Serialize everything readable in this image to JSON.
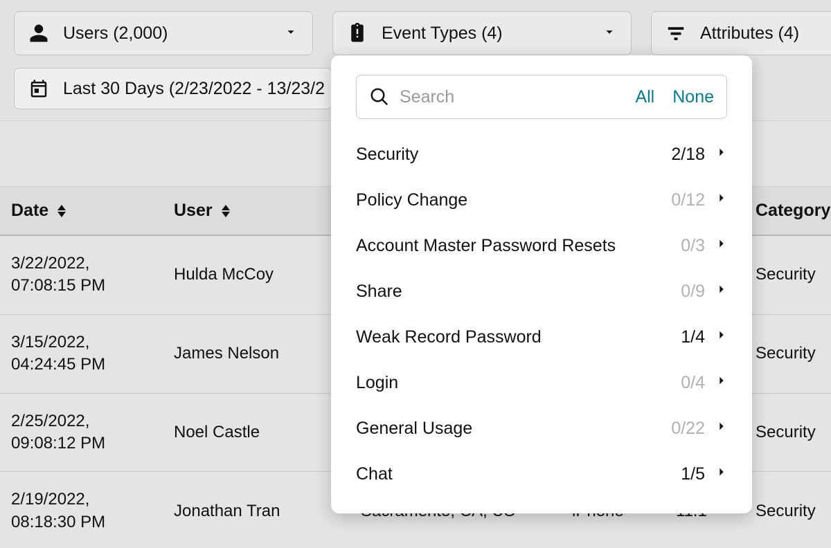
{
  "filters": {
    "users": {
      "label": "Users (2,000)"
    },
    "event_types": {
      "label": "Event Types (4)"
    },
    "attributes": {
      "label": "Attributes (4)"
    },
    "date": {
      "label": "Last 30 Days (2/23/2022 - 13/23/2"
    }
  },
  "dropdown": {
    "search_placeholder": "Search",
    "link_all": "All",
    "link_none": "None",
    "rows": [
      {
        "name": "Security",
        "count": "2/18",
        "zero": false
      },
      {
        "name": "Policy Change",
        "count": "0/12",
        "zero": true
      },
      {
        "name": "Account Master Password Resets",
        "count": "0/3",
        "zero": true
      },
      {
        "name": "Share",
        "count": "0/9",
        "zero": true
      },
      {
        "name": "Weak Record Password",
        "count": "1/4",
        "zero": false
      },
      {
        "name": "Login",
        "count": "0/4",
        "zero": true
      },
      {
        "name": "General Usage",
        "count": "0/22",
        "zero": true
      },
      {
        "name": "Chat",
        "count": "1/5",
        "zero": false
      }
    ]
  },
  "table": {
    "headers": {
      "date": "Date",
      "user": "User",
      "location": "",
      "device": "",
      "version": "",
      "category": "Category"
    },
    "rows": [
      {
        "date": "3/22/2022,\n07:08:15 PM",
        "user": "Hulda McCoy",
        "location": "",
        "device": "",
        "version": "",
        "category": "Security"
      },
      {
        "date": "3/15/2022,\n04:24:45 PM",
        "user": "James Nelson",
        "location": "",
        "device": "",
        "version": "",
        "category": "Security"
      },
      {
        "date": "2/25/2022,\n09:08:12 PM",
        "user": "Noel Castle",
        "location": "",
        "device": "",
        "version": "",
        "category": "Security"
      },
      {
        "date": "2/19/2022,\n08:18:30 PM",
        "user": "Jonathan Tran",
        "location": "Sacramento, CA, US",
        "device": "iPhone",
        "version": "11.1",
        "category": "Security"
      }
    ]
  }
}
